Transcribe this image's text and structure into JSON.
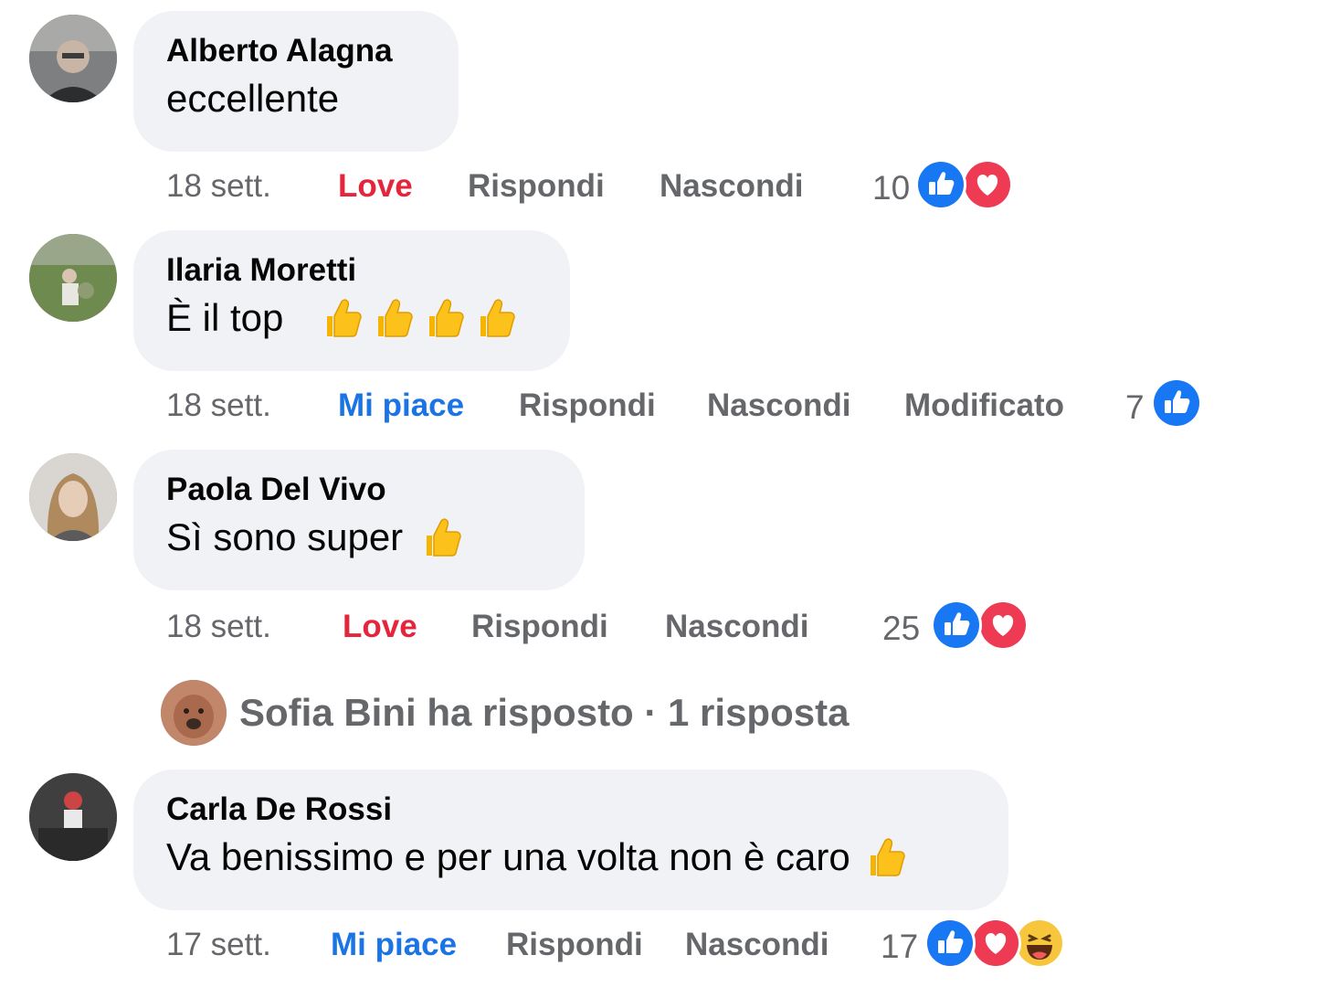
{
  "colors": {
    "bubble": "#f0f2f5",
    "meta_gray": "#65676b",
    "like_blue": "#1b74e4",
    "love_red": "#e4253c"
  },
  "comments": [
    {
      "author": "Alberto Alagna",
      "text": "eccellente",
      "emojis": [],
      "time": "18 sett.",
      "reaction_label": "Love",
      "reply": "Rispondi",
      "hide": "Nascondi",
      "edited": "",
      "count": "10",
      "reaction_icons": [
        "like-icon",
        "love-icon"
      ]
    },
    {
      "author": "Ilaria Moretti",
      "text": "È il top",
      "emojis": [
        "thumbs-up-emoji",
        "thumbs-up-emoji",
        "thumbs-up-emoji",
        "thumbs-up-emoji"
      ],
      "time": "18 sett.",
      "reaction_label": "Mi piace",
      "reply": "Rispondi",
      "hide": "Nascondi",
      "edited": "Modificato",
      "count": "7",
      "reaction_icons": [
        "like-icon"
      ]
    },
    {
      "author": "Paola Del Vivo",
      "text": "Sì sono super",
      "emojis": [
        "thumbs-up-emoji"
      ],
      "time": "18 sett.",
      "reaction_label": "Love",
      "reply": "Rispondi",
      "hide": "Nascondi",
      "edited": "",
      "count": "25",
      "reaction_icons": [
        "like-icon",
        "love-icon"
      ]
    },
    {
      "author": "Carla De Rossi",
      "text": "Va benissimo e per una volta non è caro",
      "emojis": [
        "thumbs-up-emoji"
      ],
      "time": "17 sett.",
      "reaction_label": "Mi piace",
      "reply": "Rispondi",
      "hide": "Nascondi",
      "edited": "",
      "count": "17",
      "reaction_icons": [
        "like-icon",
        "love-icon",
        "haha-icon"
      ]
    }
  ],
  "reply_summary": {
    "text": "Sofia Bini ha risposto · 1 risposta"
  }
}
